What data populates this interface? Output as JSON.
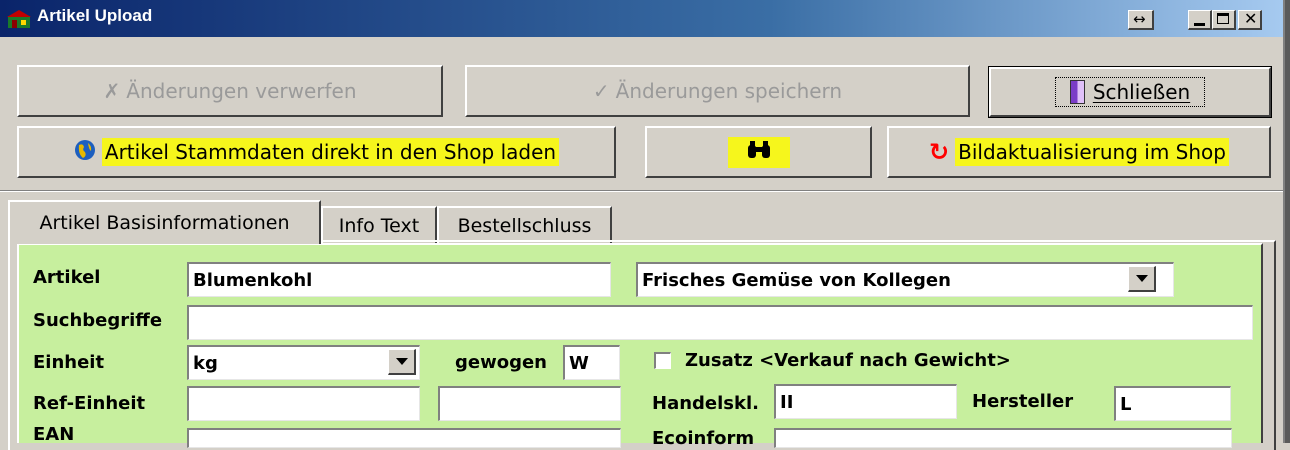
{
  "window": {
    "title": "Artikel Upload"
  },
  "toolbar": {
    "discard_label": "Änderungen verwerfen",
    "save_label": "Änderungen speichern",
    "close_label": "Schließen",
    "upload_label": "Artikel Stammdaten direkt in den Shop laden",
    "image_update_label": "Bildaktualisierung im Shop"
  },
  "tabs": [
    {
      "label": "Artikel Basisinformationen"
    },
    {
      "label": "Info Text"
    },
    {
      "label": "Bestellschluss"
    }
  ],
  "form": {
    "artikel_label": "Artikel",
    "artikel_value": "Blumenkohl",
    "kategorie_value": "Frisches Gemüse von Kollegen",
    "suchbegriffe_label": "Suchbegriffe",
    "suchbegriffe_value": "",
    "einheit_label": "Einheit",
    "einheit_value": "kg",
    "gewogen_label": "gewogen",
    "gewogen_value": "W",
    "zusatz_label": "Zusatz <Verkauf nach Gewicht>",
    "ref_einheit_label": "Ref-Einheit",
    "handelskl_label": "Handelskl.",
    "handelskl_value": "II",
    "hersteller_label": "Hersteller",
    "hersteller_value": "L",
    "ean_label": "EAN",
    "ecoinform_label": "Ecoinform"
  },
  "colors": {
    "panel": "#c7ef9e",
    "highlight": "#f6f61c",
    "titlebar": "#0a246a"
  }
}
